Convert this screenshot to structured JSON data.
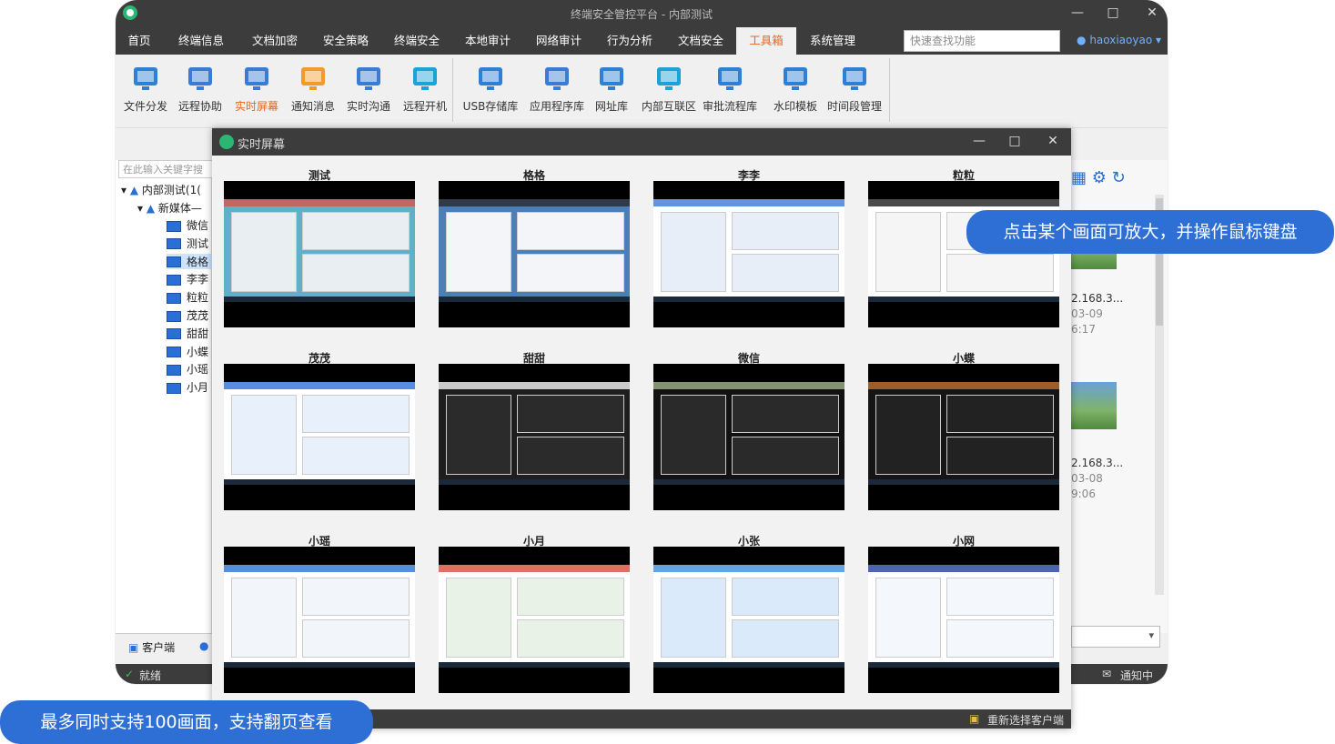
{
  "window": {
    "title": "终端安全管控平台 - 内部测试"
  },
  "menu": [
    "首页",
    "终端信息",
    "文档加密",
    "安全策略",
    "终端安全",
    "本地审计",
    "网络审计",
    "行为分析",
    "文档安全",
    "工具箱",
    "系统管理"
  ],
  "menu_active": "工具箱",
  "search": {
    "placeholder": "快速查找功能"
  },
  "user": {
    "name": "haoxiaoyao"
  },
  "toolbar": {
    "items": [
      {
        "label": "文件分发",
        "icon": "paper-plane-icon"
      },
      {
        "label": "远程协助",
        "icon": "remote-assist-icon"
      },
      {
        "label": "实时屏幕",
        "icon": "live-screen-icon"
      },
      {
        "label": "通知消息",
        "icon": "bell-icon"
      },
      {
        "label": "实时沟通",
        "icon": "chat-icon"
      },
      {
        "label": "远程开机",
        "icon": "remote-boot-icon"
      },
      {
        "label": "USB存储库",
        "icon": "usb-icon"
      },
      {
        "label": "应用程序库",
        "icon": "app-library-icon"
      },
      {
        "label": "网址库",
        "icon": "globe-icon"
      },
      {
        "label": "内部互联区",
        "icon": "intranet-icon"
      },
      {
        "label": "审批流程库",
        "icon": "approval-gear-icon"
      },
      {
        "label": "水印模板",
        "icon": "watermark-icon"
      },
      {
        "label": "时间段管理",
        "icon": "time-gear-icon"
      }
    ],
    "active": "实时屏幕"
  },
  "tree": {
    "search_placeholder": "在此输入关键字搜",
    "root": "内部测试(1(",
    "group": "新媒体—",
    "clients": [
      "微信",
      "测试",
      "格格",
      "李李",
      "粒粒",
      "茂茂",
      "甜甜",
      "小蝶",
      "小瑶",
      "小月"
    ],
    "selected": "格格"
  },
  "bottom_tabs": {
    "client_tab": "客户端"
  },
  "status": {
    "ready": "就绪",
    "notify": "通知中"
  },
  "right_panel": {
    "entries": [
      {
        "ip": "2.168.3...",
        "date": "03-09",
        "time": "6:17"
      },
      {
        "ip": "2.168.3...",
        "date": "03-08",
        "time": "9:06"
      }
    ]
  },
  "dialog": {
    "title": "实时屏幕",
    "screens": [
      "测试",
      "格格",
      "李李",
      "粒粒",
      "茂茂",
      "甜甜",
      "微信",
      "小蝶",
      "小瑶",
      "小月",
      "小张",
      "小网"
    ],
    "footer_action": "重新选择客户端"
  },
  "callouts": {
    "right": "点击某个画面可放大，并操作鼠标键盘",
    "bottom": "最多同时支持100画面，支持翻页查看"
  },
  "colors": {
    "accent": "#e8661b",
    "dark_chrome": "#3c3c3c",
    "bubble": "#2e6fd6"
  }
}
